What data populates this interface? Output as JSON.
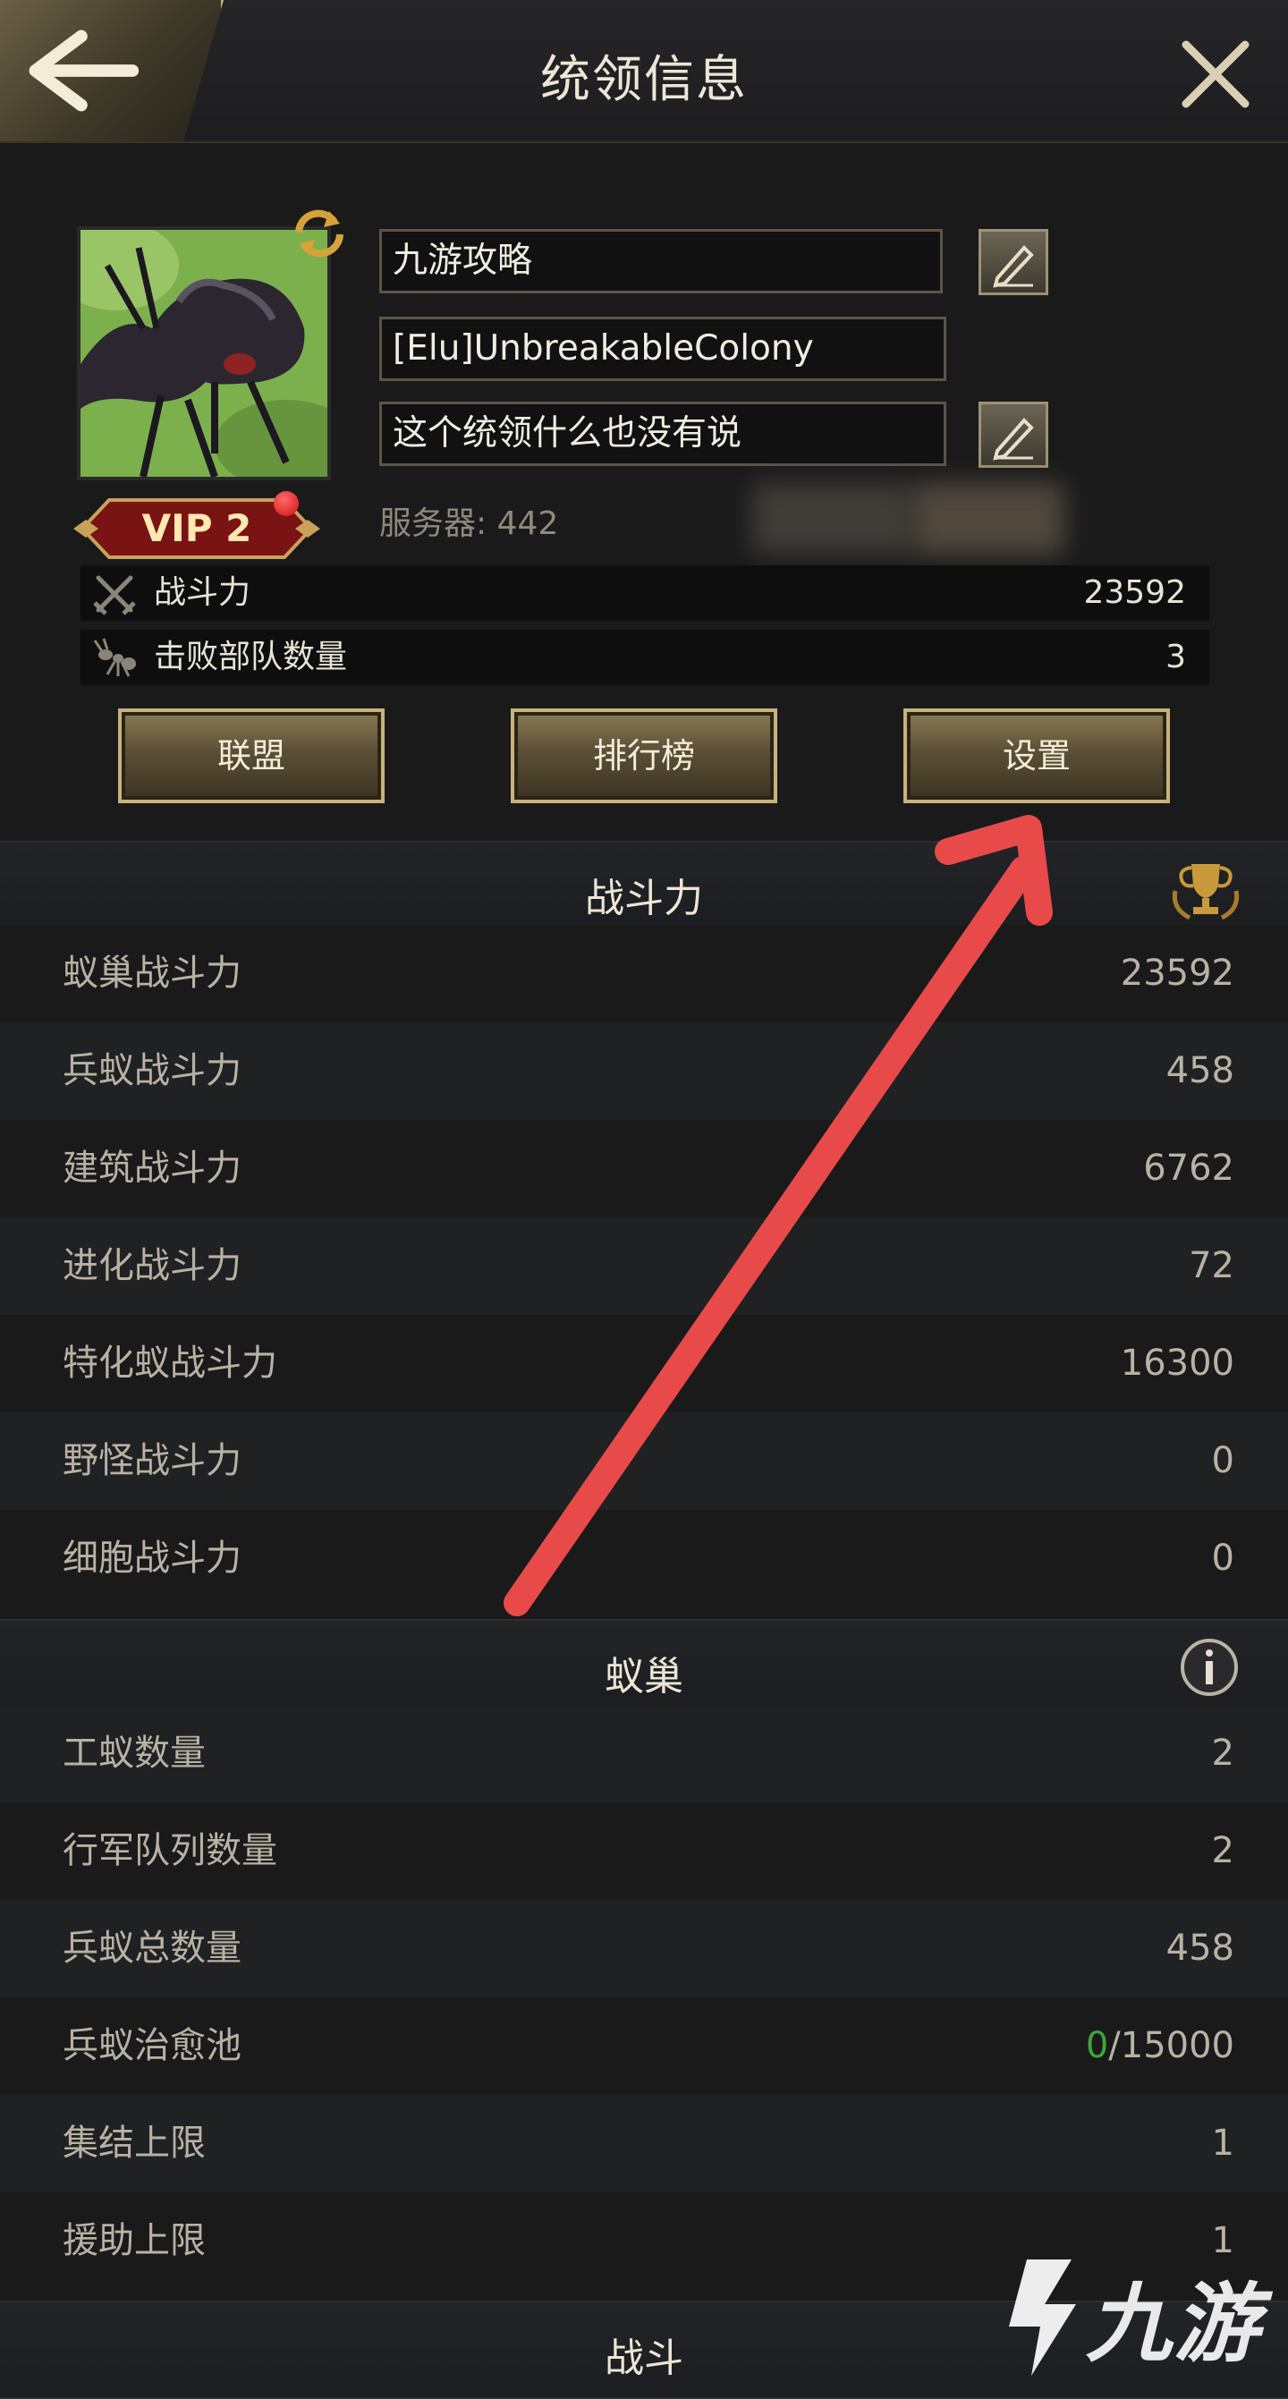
{
  "header": {
    "title": "统领信息"
  },
  "profile": {
    "name": "九游攻略",
    "alliance_tag": "[Elu]UnbreakableColony",
    "signature": "这个统领什么也没有说",
    "server": "服务器: 442",
    "vip": "VIP 2"
  },
  "summary": [
    {
      "label": "战斗力",
      "value": "23592",
      "icon": "crossed-swords-icon"
    },
    {
      "label": "击败部队数量",
      "value": "3",
      "icon": "ant-icon"
    }
  ],
  "buttons": {
    "alliance": "联盟",
    "ranking": "排行榜",
    "settings": "设置"
  },
  "sections": [
    {
      "title": "战斗力",
      "icon": "trophy-icon",
      "rows": [
        {
          "label": "蚁巢战斗力",
          "value": "23592"
        },
        {
          "label": "兵蚁战斗力",
          "value": "458"
        },
        {
          "label": "建筑战斗力",
          "value": "6762"
        },
        {
          "label": "进化战斗力",
          "value": "72"
        },
        {
          "label": "特化蚁战斗力",
          "value": "16300"
        },
        {
          "label": "野怪战斗力",
          "value": "0"
        },
        {
          "label": "细胞战斗力",
          "value": "0"
        }
      ]
    },
    {
      "title": "蚁巢",
      "icon": "info-icon",
      "rows": [
        {
          "label": "工蚁数量",
          "value": "2"
        },
        {
          "label": "行军队列数量",
          "value": "2"
        },
        {
          "label": "兵蚁总数量",
          "value": "458"
        },
        {
          "label": "兵蚁治愈池",
          "value_green": "0",
          "value_rest": "/15000"
        },
        {
          "label": "集结上限",
          "value": "1"
        },
        {
          "label": "援助上限",
          "value": "1"
        }
      ]
    },
    {
      "title": "战斗"
    }
  ],
  "watermark": "九游",
  "colors": {
    "accent_gold": "#c8b27c",
    "arrow_red": "#e84a4a",
    "positive_green": "#3fa43a"
  }
}
